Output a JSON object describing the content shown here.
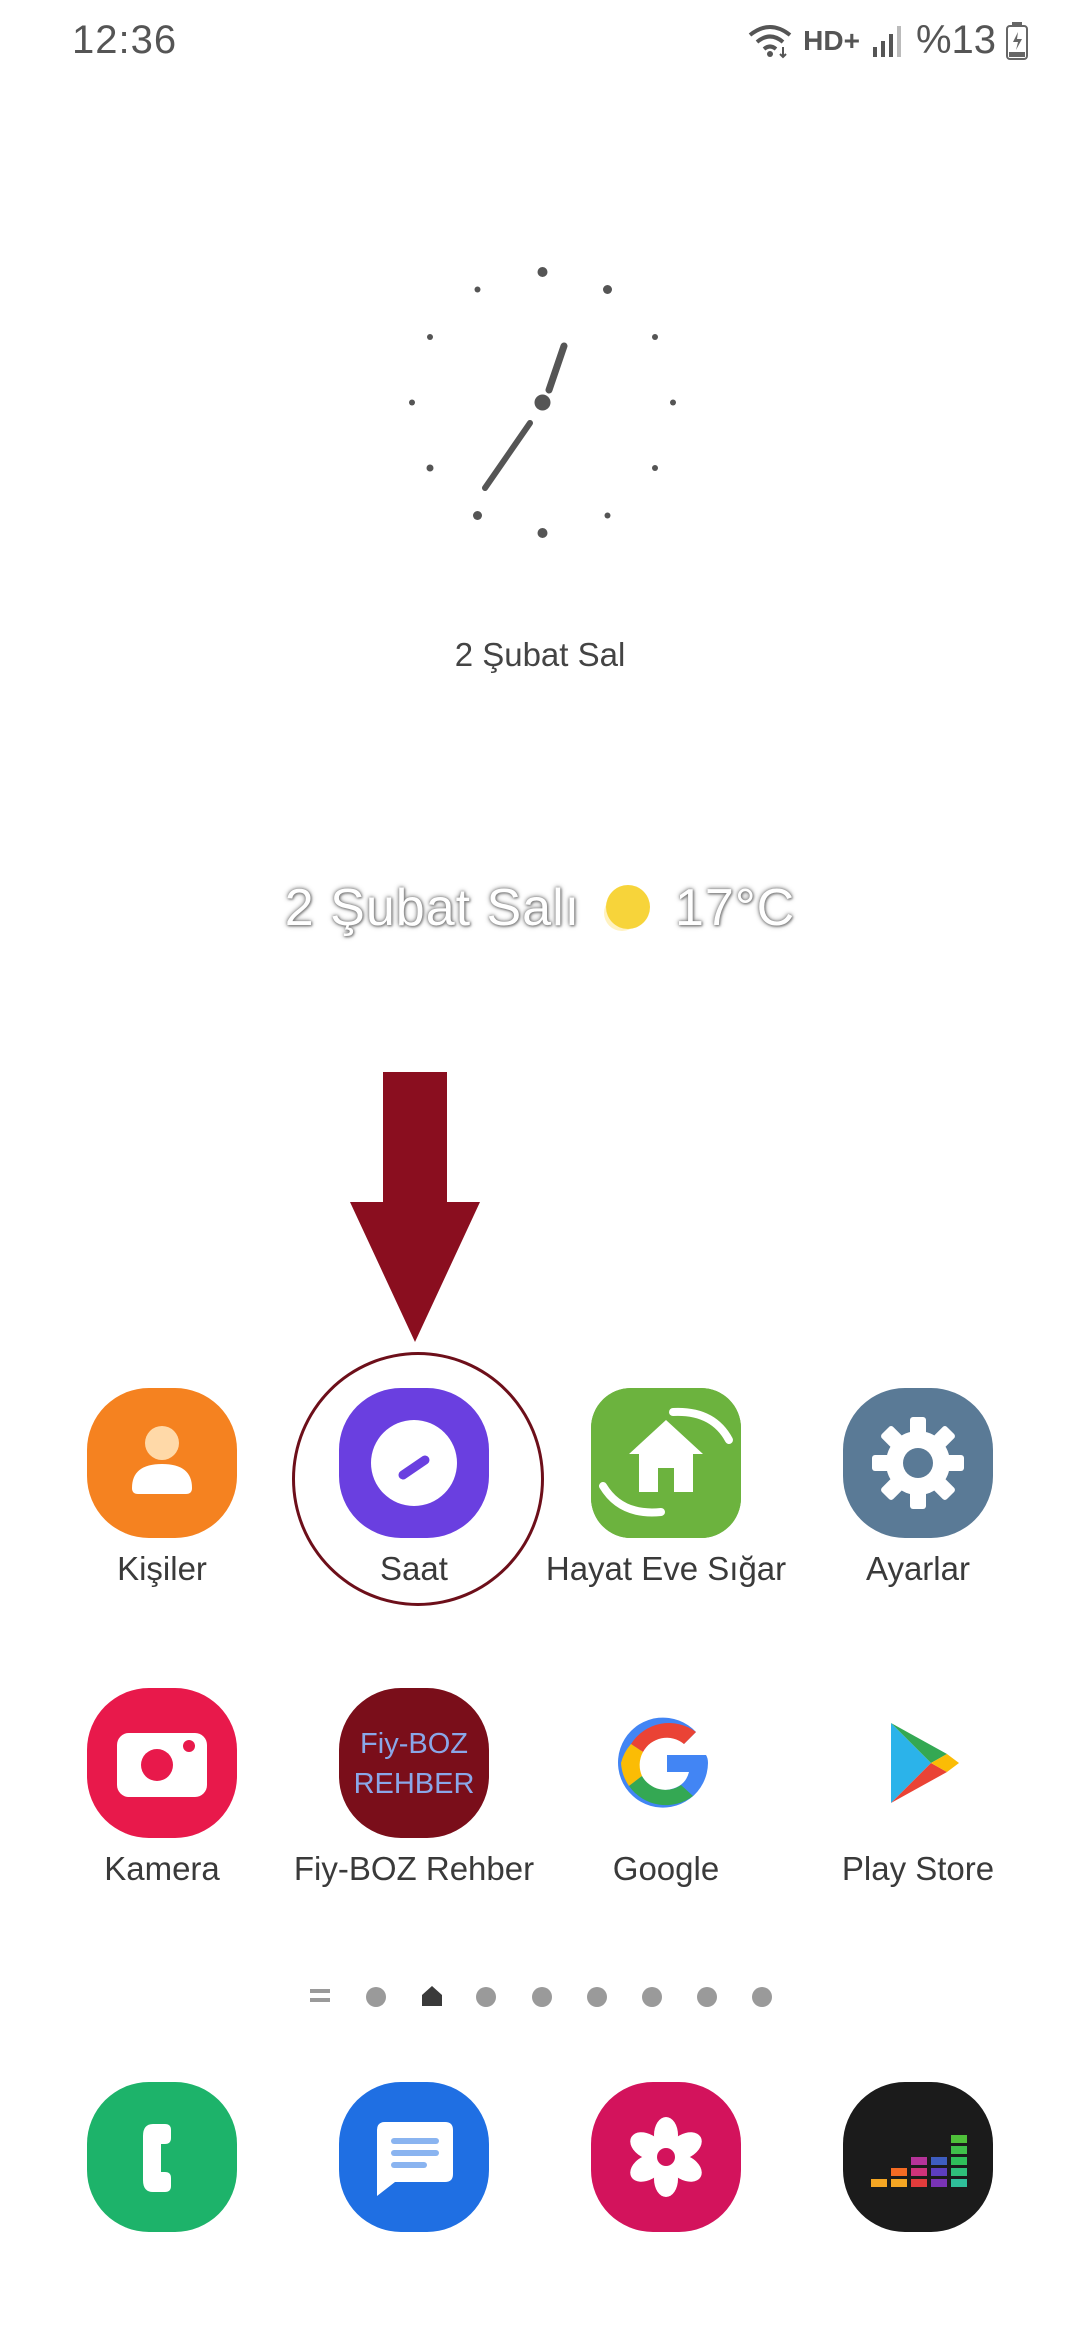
{
  "status_bar": {
    "time": "12:36",
    "network_label": "HD+",
    "battery_text": "%13"
  },
  "clock_widget": {
    "date": "2 Şubat Sal"
  },
  "weather_widget": {
    "date": "2 Şubat Salı",
    "temperature": "17°C",
    "icon": "sun-icon"
  },
  "annotation": {
    "arrow_color": "#8a0e1f",
    "circle_color": "#6d0f1a"
  },
  "apps_row1": [
    {
      "label": "Kişiler",
      "icon": "contacts-icon",
      "color": "#f58220"
    },
    {
      "label": "Saat",
      "icon": "clock-app-icon",
      "color": "#6a3fe0"
    },
    {
      "label": "Hayat Eve Sığar",
      "icon": "house-hands-icon",
      "color": "#6cb33e"
    },
    {
      "label": "Ayarlar",
      "icon": "gear-icon",
      "color": "#5a7a96"
    }
  ],
  "apps_row2": [
    {
      "label": "Kamera",
      "icon": "camera-icon",
      "color": "#e8194b"
    },
    {
      "label": "Fiy-BOZ Rehber",
      "icon": "fiyboz-icon",
      "color": "#7a0e1a",
      "icon_text_1": "Fiy-BOZ",
      "icon_text_2": "REHBER"
    },
    {
      "label": "Google",
      "icon": "google-icon",
      "color": "#ffffff"
    },
    {
      "label": "Play Store",
      "icon": "play-store-icon",
      "color": "#ffffff"
    }
  ],
  "page_indicator": {
    "pages": 9,
    "current_home": 2
  },
  "dock": [
    {
      "icon": "phone-icon",
      "color": "#1db36a"
    },
    {
      "icon": "messages-icon",
      "color": "#1f6fe3"
    },
    {
      "icon": "flower-icon",
      "color": "#d3135c"
    },
    {
      "icon": "deezer-icon",
      "color": "#1b1b1b"
    }
  ]
}
